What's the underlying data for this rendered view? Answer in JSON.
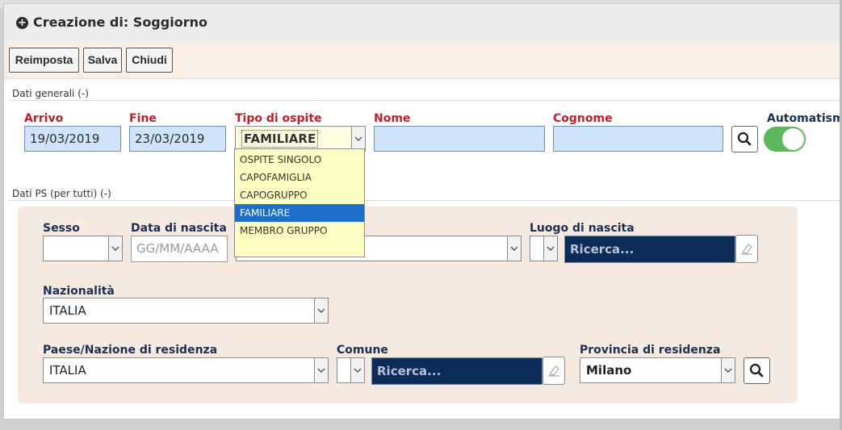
{
  "dialog": {
    "title": "Creazione di: Soggiorno",
    "title_icon": "plus-circle-icon"
  },
  "toolbar": {
    "reset_label": "Reimposta",
    "save_label": "Salva",
    "close_label": "Chiudi"
  },
  "general": {
    "section_label": "Dati generali (-)",
    "arrivo_label": "Arrivo",
    "arrivo_value": "19/03/2019",
    "fine_label": "Fine",
    "fine_value": "23/03/2019",
    "tipo_label": "Tipo di ospite",
    "tipo_value": "FAMILIARE",
    "tipo_options": [
      "OSPITE SINGOLO",
      "CAPOFAMIGLIA",
      "CAPOGRUPPO",
      "FAMILIARE",
      "MEMBRO GRUPPO"
    ],
    "tipo_selected_index": 3,
    "nome_label": "Nome",
    "nome_value": "",
    "cognome_label": "Cognome",
    "cognome_value": "",
    "search_icon": "search-icon",
    "automatismi_label": "Automatismi",
    "automatismi_on": true
  },
  "ps": {
    "section_label": "Dati PS (per tutti) (-)",
    "sesso_label": "Sesso",
    "sesso_value": "",
    "data_nascita_label": "Data di nascita",
    "data_nascita_placeholder": "GG/MM/AAAA",
    "luogo_label": "Luogo di nascita",
    "luogo_placeholder": "Ricerca...",
    "nazionalita_label": "Nazionalità",
    "nazionalita_value": "ITALIA",
    "paese_label": "Paese/Nazione di residenza",
    "paese_value": "ITALIA",
    "comune_label": "Comune",
    "comune_placeholder": "Ricerca...",
    "provincia_label": "Provincia di residenza",
    "provincia_value": "Milano",
    "edit_icon": "eraser-icon"
  },
  "colors": {
    "required_label": "#b8212e",
    "section_label": "#1c2f55",
    "toggle_on": "#5cb85c",
    "dropdown_bg": "#ffffc4",
    "dropdown_selected": "#1e6dc9"
  }
}
